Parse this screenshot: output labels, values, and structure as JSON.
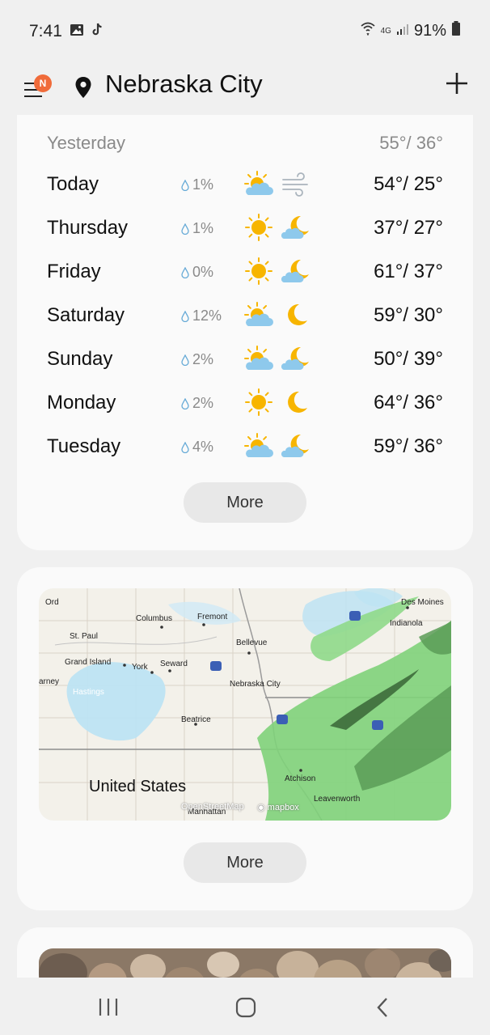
{
  "status_bar": {
    "time": "7:41",
    "network": "4G",
    "battery": "91%"
  },
  "header": {
    "badge": "N",
    "city": "Nebraska City"
  },
  "forecast": {
    "yesterday": {
      "label": "Yesterday",
      "temps": "55°/ 36°"
    },
    "days": [
      {
        "name": "Today",
        "precip": "1%",
        "day_icon": "partly-cloudy-icon",
        "night_icon": "wind-icon",
        "temps": "54°/ 25°"
      },
      {
        "name": "Thursday",
        "precip": "1%",
        "day_icon": "sun-icon",
        "night_icon": "partly-cloudy-night-icon",
        "temps": "37°/ 27°"
      },
      {
        "name": "Friday",
        "precip": "0%",
        "day_icon": "sun-icon",
        "night_icon": "partly-cloudy-night-icon",
        "temps": "61°/ 37°"
      },
      {
        "name": "Saturday",
        "precip": "12%",
        "day_icon": "partly-cloudy-icon",
        "night_icon": "moon-icon",
        "temps": "59°/ 30°"
      },
      {
        "name": "Sunday",
        "precip": "2%",
        "day_icon": "partly-cloudy-icon",
        "night_icon": "partly-cloudy-night-icon",
        "temps": "50°/ 39°"
      },
      {
        "name": "Monday",
        "precip": "2%",
        "day_icon": "sun-icon",
        "night_icon": "moon-icon",
        "temps": "64°/ 36°"
      },
      {
        "name": "Tuesday",
        "precip": "4%",
        "day_icon": "partly-cloudy-icon",
        "night_icon": "partly-cloudy-night-icon",
        "temps": "59°/ 36°"
      }
    ],
    "more_label": "More"
  },
  "map": {
    "labels": [
      "Ord",
      "Columbus",
      "Fremont",
      "Des Moines",
      "Indianola",
      "St. Paul",
      "Bellevue",
      "Grand Island",
      "York",
      "Seward",
      "Nebraska City",
      "Hastings",
      "Beatrice",
      "Atchison",
      "Leavenworth",
      "Manhattan",
      "arney"
    ],
    "country": "United States",
    "attribution_osm": "OpenStreetMap",
    "attribution_mapbox": "mapbox",
    "more_label": "More"
  },
  "colors": {
    "badge": "#f06b3a",
    "card": "#fafafa",
    "button": "#e8e8e8",
    "sun": "#f7b500",
    "cloud": "#8ec9ec"
  }
}
